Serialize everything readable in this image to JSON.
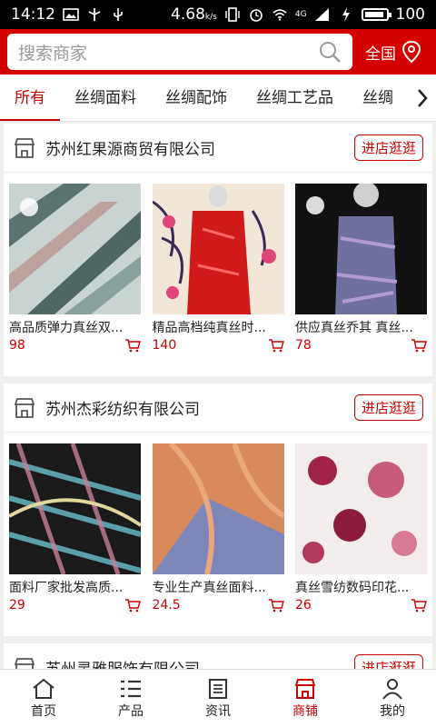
{
  "status_bar": {
    "time": "14:12",
    "speed": "4.68",
    "speed_unit": "k/s",
    "network": "4G",
    "battery": "100"
  },
  "search": {
    "placeholder": "搜索商家",
    "region": "全国"
  },
  "tabs": [
    "所有",
    "丝绸面料",
    "丝绸配饰",
    "丝绸工艺品",
    "丝绸"
  ],
  "shops": [
    {
      "name": "苏州红果源商贸有限公司",
      "visit_label": "进店逛逛",
      "products": [
        {
          "title": "高品质弹力真丝双...",
          "price": "98"
        },
        {
          "title": "精品高档纯真丝时...",
          "price": "140"
        },
        {
          "title": "供应真丝乔其 真丝...",
          "price": "78"
        }
      ]
    },
    {
      "name": "苏州杰彩纺织有限公司",
      "visit_label": "进店逛逛",
      "products": [
        {
          "title": "面料厂家批发高质...",
          "price": "29"
        },
        {
          "title": "专业生产真丝面料...",
          "price": "24.5"
        },
        {
          "title": "真丝雪纺数码印花...",
          "price": "26"
        }
      ]
    },
    {
      "name": "苏州灵雅服饰有限公司",
      "visit_label": "进店逛逛"
    }
  ],
  "bottom_nav": [
    {
      "label": "首页",
      "icon": "home-icon"
    },
    {
      "label": "产品",
      "icon": "list-icon"
    },
    {
      "label": "资讯",
      "icon": "news-icon"
    },
    {
      "label": "商铺",
      "icon": "shop-icon"
    },
    {
      "label": "我的",
      "icon": "user-icon"
    }
  ],
  "colors": {
    "brand": "#d40000",
    "price": "#cc0000"
  }
}
